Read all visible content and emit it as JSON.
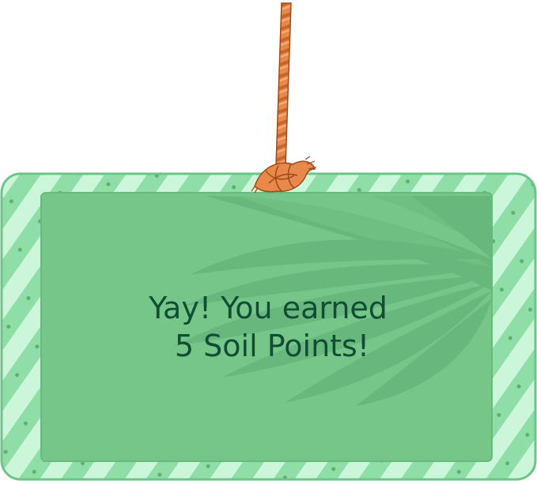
{
  "popup": {
    "line1": "Yay! You earned",
    "line2": "5 Soil Points!"
  },
  "colors": {
    "board_fill": "#77c689",
    "board_frame": "#8fdda7",
    "frame_stripe_light": "#ccf6d9",
    "leaf_shadow": "#62b077",
    "text": "#114d34",
    "rope": "#e8894b",
    "rope_dark": "#b5561f"
  },
  "icons": {
    "rope": "hanging-rope-icon",
    "knot": "rope-knot-icon",
    "leaf": "palm-leaf-watermark-icon"
  }
}
